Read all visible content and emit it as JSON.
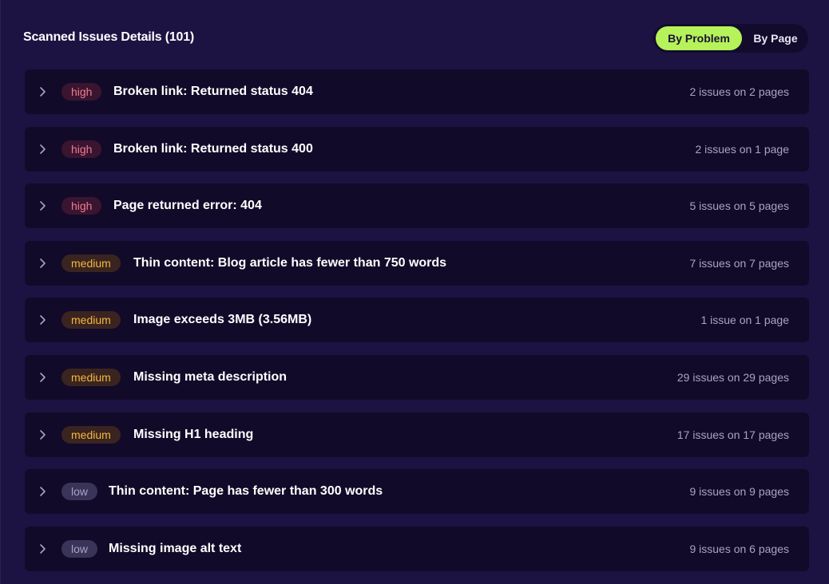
{
  "header": {
    "title": "Scanned Issues Details (101)",
    "toggle": {
      "active_label": "By Problem",
      "inactive_label": "By Page"
    }
  },
  "colors": {
    "accent": "#b6f25a",
    "high": "#f07a8f",
    "medium": "#f5b73c",
    "low": "#a8a2c4"
  },
  "issues": [
    {
      "severity": "high",
      "title": "Broken link: Returned status 404",
      "count": "2 issues on 2 pages"
    },
    {
      "severity": "high",
      "title": "Broken link: Returned status 400",
      "count": "2 issues on 1 page"
    },
    {
      "severity": "high",
      "title": "Page returned error: 404",
      "count": "5 issues on 5 pages"
    },
    {
      "severity": "medium",
      "title": "Thin content: Blog article has fewer than 750 words",
      "count": "7 issues on 7 pages"
    },
    {
      "severity": "medium",
      "title": "Image exceeds 3MB (3.56MB)",
      "count": "1 issue on 1 page"
    },
    {
      "severity": "medium",
      "title": "Missing meta description",
      "count": "29 issues on 29 pages"
    },
    {
      "severity": "medium",
      "title": "Missing H1 heading",
      "count": "17 issues on 17 pages"
    },
    {
      "severity": "low",
      "title": "Thin content: Page has fewer than 300 words",
      "count": "9 issues on 9 pages"
    },
    {
      "severity": "low",
      "title": "Missing image alt text",
      "count": "9 issues on 6 pages"
    }
  ]
}
